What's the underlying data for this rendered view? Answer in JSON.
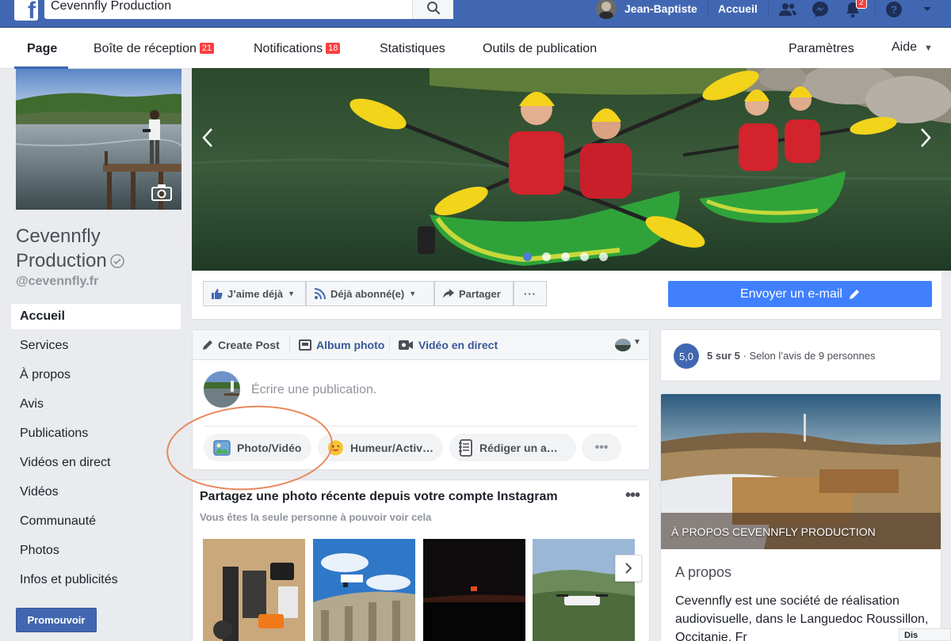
{
  "topbar": {
    "logo": "f",
    "search_value": "Cevennfly Production",
    "user_name": "Jean-Baptiste",
    "home_label": "Accueil",
    "notification_count": "2",
    "icons": [
      "friend-requests-icon",
      "messenger-icon",
      "notifications-icon",
      "help-icon",
      "account-menu-caret-icon"
    ]
  },
  "page_nav": {
    "items": [
      {
        "label": "Page"
      },
      {
        "label": "Boîte de réception",
        "badge": "21"
      },
      {
        "label": "Notifications",
        "badge": "18"
      },
      {
        "label": "Statistiques"
      },
      {
        "label": "Outils de publication"
      }
    ],
    "settings_label": "Paramètres",
    "help_label": "Aide"
  },
  "profile": {
    "name": "Cevennfly Production",
    "handle": "@cevennfly.fr"
  },
  "left_nav": [
    {
      "label": "Accueil",
      "active": true
    },
    {
      "label": "Services"
    },
    {
      "label": "À propos"
    },
    {
      "label": "Avis"
    },
    {
      "label": "Publications"
    },
    {
      "label": "Vidéos en direct"
    },
    {
      "label": "Vidéos"
    },
    {
      "label": "Communauté"
    },
    {
      "label": "Photos"
    },
    {
      "label": "Infos et publicités"
    }
  ],
  "promote_label": "Promouvoir",
  "cover": {
    "slide_count": 5,
    "active_slide": 1
  },
  "actions": {
    "like_label": "J’aime déjà",
    "follow_label": "Déjà abonné(e)",
    "share_label": "Partager",
    "more_label": "···",
    "email_label": "Envoyer un e-mail"
  },
  "composer": {
    "tabs": [
      "Create Post",
      "Album photo",
      "Vidéo en direct"
    ],
    "placeholder": "Écrire une publication.",
    "options": [
      "Photo/Vidéo",
      "Humeur/Activ…",
      "Rédiger un a…",
      "•••"
    ]
  },
  "instagram": {
    "title": "Partagez une photo récente depuis votre compte Instagram",
    "subtitle": "Vous êtes la seule personne à pouvoir voir cela",
    "more": "•••"
  },
  "rating": {
    "badge": "5,0",
    "score": "5 sur 5",
    "separator": " · ",
    "text": "Selon l’avis de 9 personnes"
  },
  "about": {
    "image_caption": "À PROPOS CEVENNFLY PRODUCTION",
    "heading": "A propos",
    "body": "Cevennfly est une société de réalisation audiovisuelle, dans le Languedoc Roussillon, Occitanie, Fr"
  },
  "chat": {
    "label": "Dis"
  },
  "colors": {
    "brand_blue": "#4267b2",
    "badge_red": "#fa3e3e",
    "email_button": "#4080ff",
    "highlight_annotation": "#e8875a"
  }
}
